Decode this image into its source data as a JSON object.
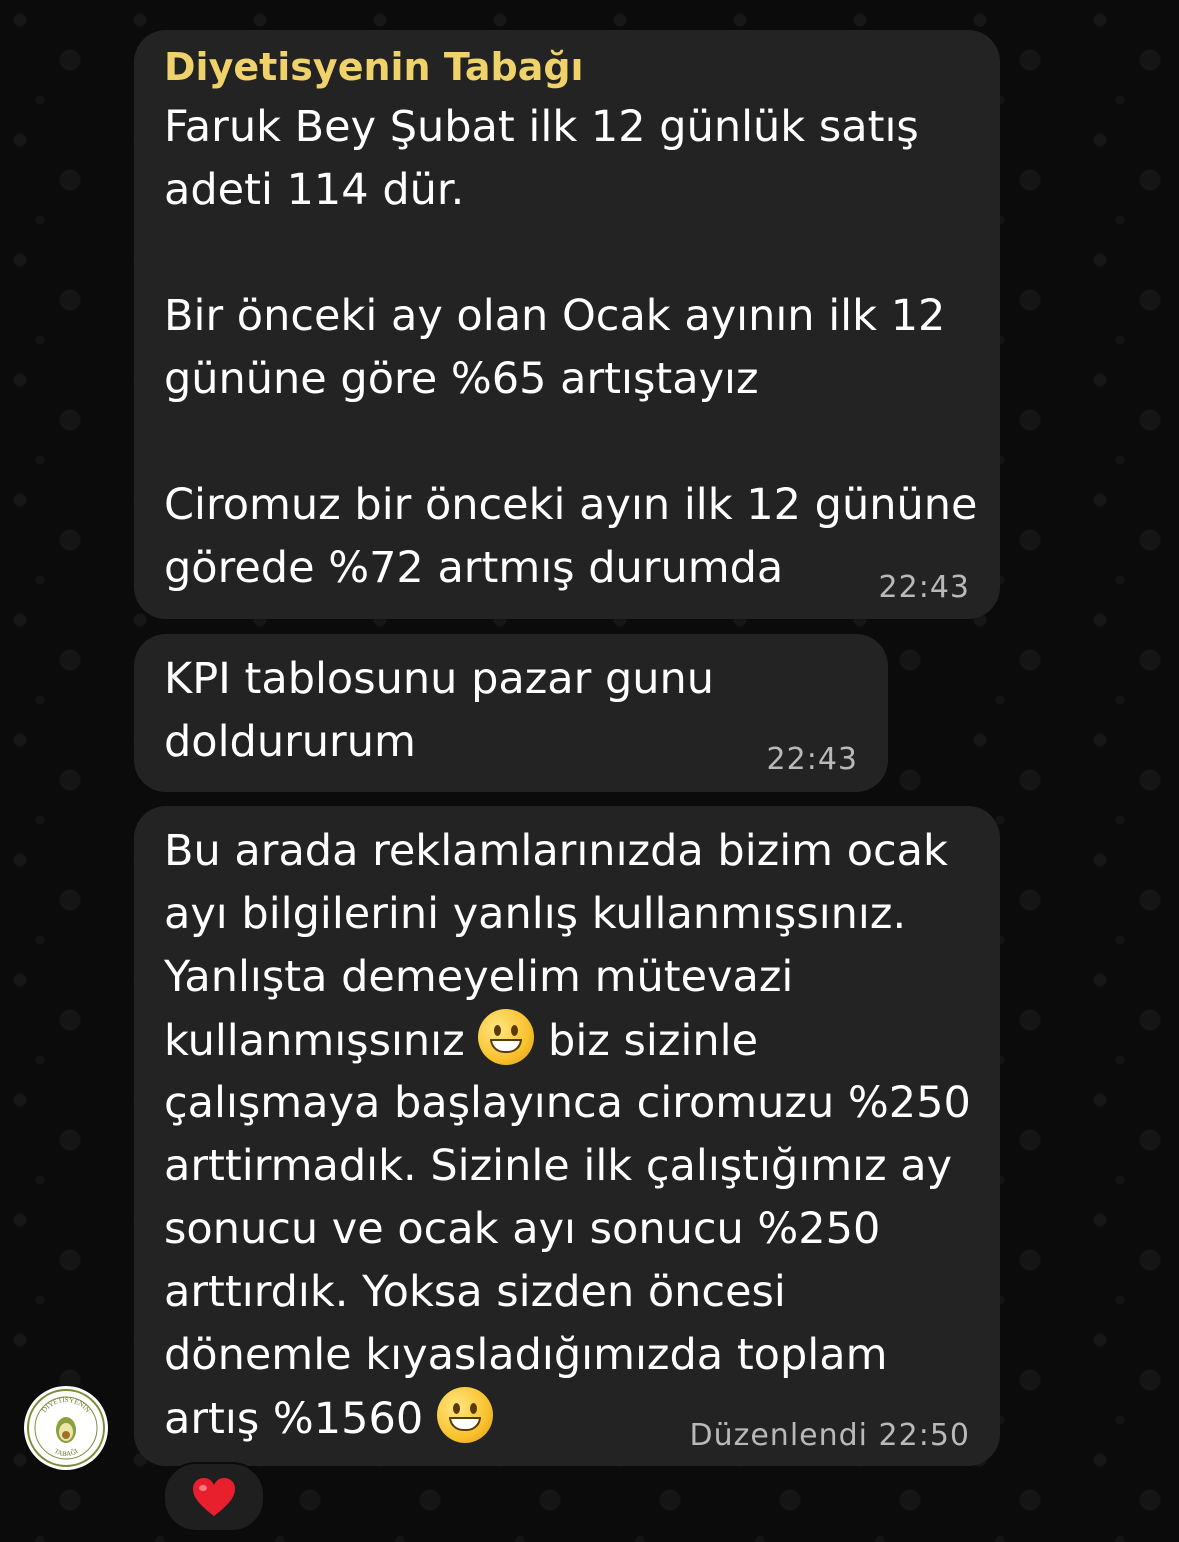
{
  "messages": [
    {
      "sender": "Diyetisyenin Tabağı",
      "lines": [
        "Faruk Bey Şubat ilk 12 günlük satış",
        "adeti 114 dür.",
        "",
        "Bir önceki ay olan Ocak ayının ilk 12",
        "gününe göre %65 artıştayız",
        "",
        "Ciromuz bir önceki ayın ilk 12 gününe",
        "görede %72 artmış durumda"
      ],
      "time": "22:43"
    },
    {
      "lines": [
        "KPI tablosunu pazar gunu",
        "doldururum"
      ],
      "time": "22:43"
    },
    {
      "lines": [
        "Bu arada reklamlarınızda bizim ocak",
        "ayı bilgilerini yanlış kullanmışsınız.",
        "Yanlışta demeyelim mütevazi",
        "kullanmışsınız",
        "biz sizinle",
        "çalışmaya başlayınca ciromuzu %250",
        "arttirmadık. Sizinle ilk çalıştığımız ay",
        "sonucu ve ocak ayı sonucu %250",
        "arttırdık. Yoksa sizden öncesi",
        "dönemle kıyasladığımızda toplam",
        "artış %1560"
      ],
      "time": "Düzenlendi 22:50",
      "reaction": "heart-emoji"
    }
  ],
  "colors": {
    "bubble": "#232323",
    "sender": "#f0d26b",
    "timestamp": "#b9b9b9",
    "background": "#0b0b0b"
  },
  "avatar": {
    "text_top": "DİYETİSYENİN",
    "text_bottom": "TABAĞI"
  }
}
